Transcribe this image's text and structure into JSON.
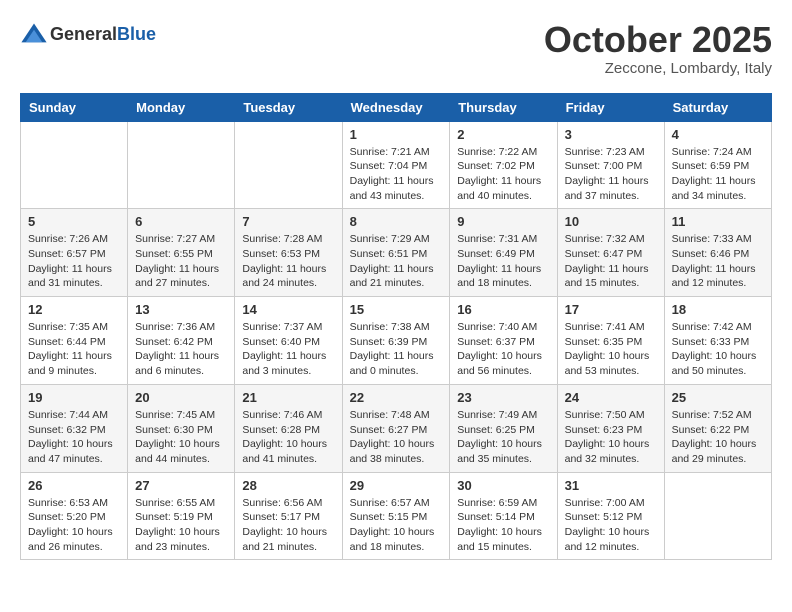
{
  "header": {
    "logo_general": "General",
    "logo_blue": "Blue",
    "month": "October 2025",
    "location": "Zeccone, Lombardy, Italy"
  },
  "weekdays": [
    "Sunday",
    "Monday",
    "Tuesday",
    "Wednesday",
    "Thursday",
    "Friday",
    "Saturday"
  ],
  "rows": [
    [
      {
        "num": "",
        "info": ""
      },
      {
        "num": "",
        "info": ""
      },
      {
        "num": "",
        "info": ""
      },
      {
        "num": "1",
        "info": "Sunrise: 7:21 AM\nSunset: 7:04 PM\nDaylight: 11 hours\nand 43 minutes."
      },
      {
        "num": "2",
        "info": "Sunrise: 7:22 AM\nSunset: 7:02 PM\nDaylight: 11 hours\nand 40 minutes."
      },
      {
        "num": "3",
        "info": "Sunrise: 7:23 AM\nSunset: 7:00 PM\nDaylight: 11 hours\nand 37 minutes."
      },
      {
        "num": "4",
        "info": "Sunrise: 7:24 AM\nSunset: 6:59 PM\nDaylight: 11 hours\nand 34 minutes."
      }
    ],
    [
      {
        "num": "5",
        "info": "Sunrise: 7:26 AM\nSunset: 6:57 PM\nDaylight: 11 hours\nand 31 minutes."
      },
      {
        "num": "6",
        "info": "Sunrise: 7:27 AM\nSunset: 6:55 PM\nDaylight: 11 hours\nand 27 minutes."
      },
      {
        "num": "7",
        "info": "Sunrise: 7:28 AM\nSunset: 6:53 PM\nDaylight: 11 hours\nand 24 minutes."
      },
      {
        "num": "8",
        "info": "Sunrise: 7:29 AM\nSunset: 6:51 PM\nDaylight: 11 hours\nand 21 minutes."
      },
      {
        "num": "9",
        "info": "Sunrise: 7:31 AM\nSunset: 6:49 PM\nDaylight: 11 hours\nand 18 minutes."
      },
      {
        "num": "10",
        "info": "Sunrise: 7:32 AM\nSunset: 6:47 PM\nDaylight: 11 hours\nand 15 minutes."
      },
      {
        "num": "11",
        "info": "Sunrise: 7:33 AM\nSunset: 6:46 PM\nDaylight: 11 hours\nand 12 minutes."
      }
    ],
    [
      {
        "num": "12",
        "info": "Sunrise: 7:35 AM\nSunset: 6:44 PM\nDaylight: 11 hours\nand 9 minutes."
      },
      {
        "num": "13",
        "info": "Sunrise: 7:36 AM\nSunset: 6:42 PM\nDaylight: 11 hours\nand 6 minutes."
      },
      {
        "num": "14",
        "info": "Sunrise: 7:37 AM\nSunset: 6:40 PM\nDaylight: 11 hours\nand 3 minutes."
      },
      {
        "num": "15",
        "info": "Sunrise: 7:38 AM\nSunset: 6:39 PM\nDaylight: 11 hours\nand 0 minutes."
      },
      {
        "num": "16",
        "info": "Sunrise: 7:40 AM\nSunset: 6:37 PM\nDaylight: 10 hours\nand 56 minutes."
      },
      {
        "num": "17",
        "info": "Sunrise: 7:41 AM\nSunset: 6:35 PM\nDaylight: 10 hours\nand 53 minutes."
      },
      {
        "num": "18",
        "info": "Sunrise: 7:42 AM\nSunset: 6:33 PM\nDaylight: 10 hours\nand 50 minutes."
      }
    ],
    [
      {
        "num": "19",
        "info": "Sunrise: 7:44 AM\nSunset: 6:32 PM\nDaylight: 10 hours\nand 47 minutes."
      },
      {
        "num": "20",
        "info": "Sunrise: 7:45 AM\nSunset: 6:30 PM\nDaylight: 10 hours\nand 44 minutes."
      },
      {
        "num": "21",
        "info": "Sunrise: 7:46 AM\nSunset: 6:28 PM\nDaylight: 10 hours\nand 41 minutes."
      },
      {
        "num": "22",
        "info": "Sunrise: 7:48 AM\nSunset: 6:27 PM\nDaylight: 10 hours\nand 38 minutes."
      },
      {
        "num": "23",
        "info": "Sunrise: 7:49 AM\nSunset: 6:25 PM\nDaylight: 10 hours\nand 35 minutes."
      },
      {
        "num": "24",
        "info": "Sunrise: 7:50 AM\nSunset: 6:23 PM\nDaylight: 10 hours\nand 32 minutes."
      },
      {
        "num": "25",
        "info": "Sunrise: 7:52 AM\nSunset: 6:22 PM\nDaylight: 10 hours\nand 29 minutes."
      }
    ],
    [
      {
        "num": "26",
        "info": "Sunrise: 6:53 AM\nSunset: 5:20 PM\nDaylight: 10 hours\nand 26 minutes."
      },
      {
        "num": "27",
        "info": "Sunrise: 6:55 AM\nSunset: 5:19 PM\nDaylight: 10 hours\nand 23 minutes."
      },
      {
        "num": "28",
        "info": "Sunrise: 6:56 AM\nSunset: 5:17 PM\nDaylight: 10 hours\nand 21 minutes."
      },
      {
        "num": "29",
        "info": "Sunrise: 6:57 AM\nSunset: 5:15 PM\nDaylight: 10 hours\nand 18 minutes."
      },
      {
        "num": "30",
        "info": "Sunrise: 6:59 AM\nSunset: 5:14 PM\nDaylight: 10 hours\nand 15 minutes."
      },
      {
        "num": "31",
        "info": "Sunrise: 7:00 AM\nSunset: 5:12 PM\nDaylight: 10 hours\nand 12 minutes."
      },
      {
        "num": "",
        "info": ""
      }
    ]
  ]
}
